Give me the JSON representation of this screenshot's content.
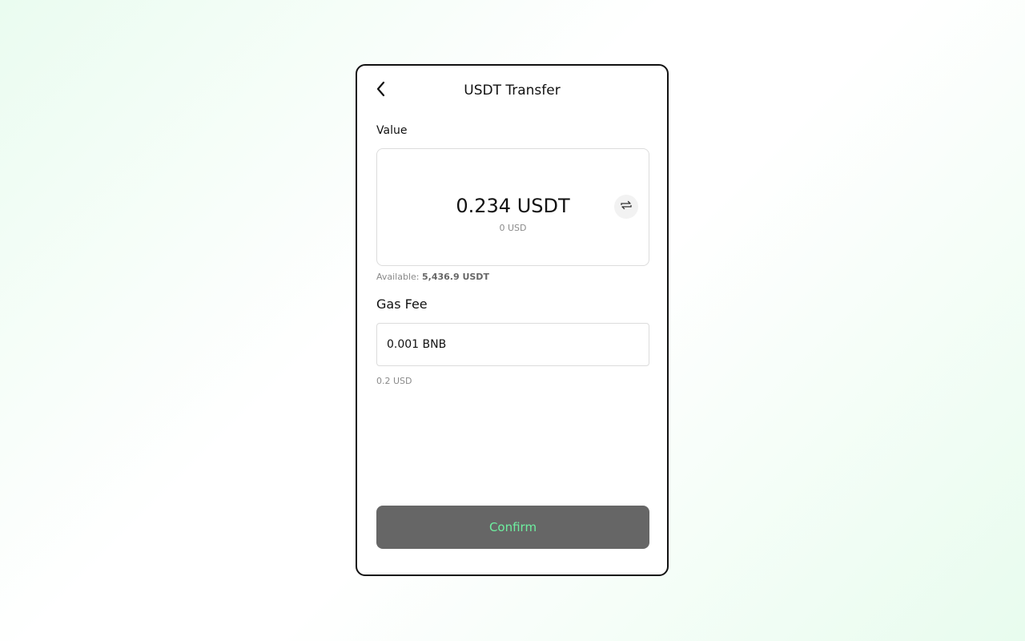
{
  "header": {
    "title": "USDT Transfer",
    "back_icon": "chevron-left-icon"
  },
  "value_section": {
    "label": "Value",
    "amount": "0.234 USDT",
    "amount_usd": "0 USD",
    "swap_icon": "swap-arrows-icon"
  },
  "available": {
    "label": "Available:",
    "value": "5,436.9 USDT"
  },
  "gas_fee": {
    "label": "Gas Fee",
    "value": "0.001 BNB",
    "usd": "0.2 USD"
  },
  "confirm": {
    "label": "Confirm"
  },
  "colors": {
    "confirm_bg": "#666666",
    "confirm_text": "#6ef0a0",
    "background_tint": "#eafcf0"
  }
}
